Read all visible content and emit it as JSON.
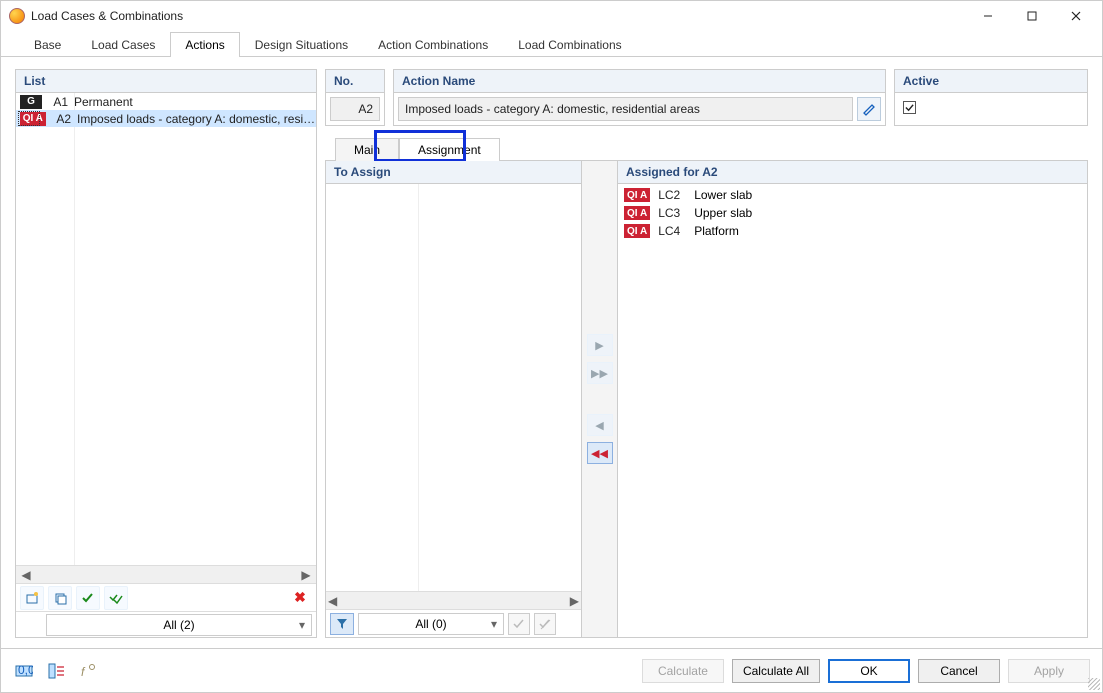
{
  "window": {
    "title": "Load Cases & Combinations"
  },
  "tabs": [
    "Base",
    "Load Cases",
    "Actions",
    "Design Situations",
    "Action Combinations",
    "Load Combinations"
  ],
  "activeTab": 2,
  "leftPanel": {
    "header": "List",
    "items": [
      {
        "badge": "G",
        "badgeClass": "g",
        "code": "A1",
        "name": "Permanent"
      },
      {
        "badge": "QI A",
        "badgeClass": "q",
        "code": "A2",
        "name": "Imposed loads - category A: domestic, residen"
      }
    ],
    "selectedIndex": 1,
    "filter": "All (2)"
  },
  "noField": {
    "header": "No.",
    "value": "A2"
  },
  "actionName": {
    "header": "Action Name",
    "value": "Imposed loads - category A: domestic, residential areas"
  },
  "active": {
    "header": "Active",
    "checked": true
  },
  "subtabs": [
    "Main",
    "Assignment"
  ],
  "activeSubtab": 1,
  "assign": {
    "leftHeader": "To Assign",
    "rightHeader": "Assigned for A2",
    "filter": "All (0)",
    "assigned": [
      {
        "badge": "QI A",
        "code": "LC2",
        "name": "Lower slab"
      },
      {
        "badge": "QI A",
        "code": "LC3",
        "name": "Upper slab"
      },
      {
        "badge": "QI A",
        "code": "LC4",
        "name": "Platform"
      }
    ]
  },
  "footer": {
    "calculate": "Calculate",
    "calculateAll": "Calculate All",
    "ok": "OK",
    "cancel": "Cancel",
    "apply": "Apply"
  }
}
